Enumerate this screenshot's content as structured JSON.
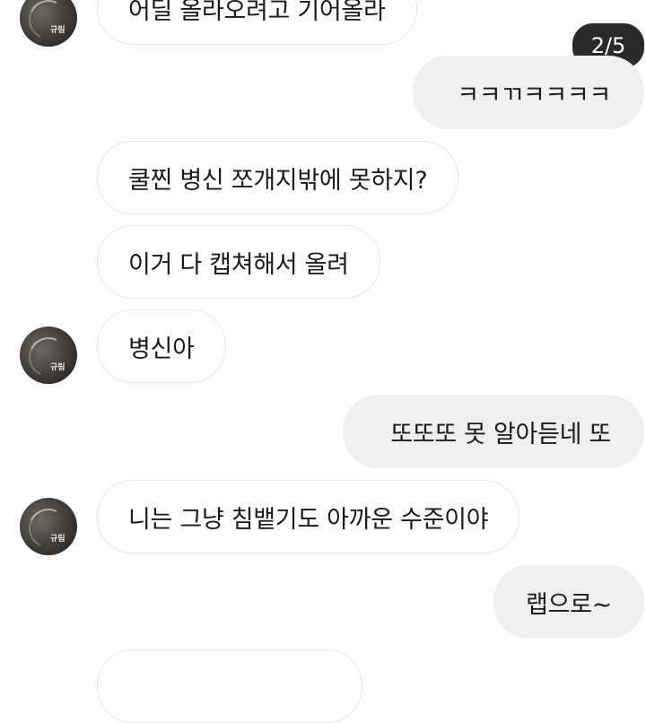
{
  "page_counter": "2/5",
  "messages": [
    {
      "direction": "incoming",
      "text": "어딜 올라오려고 기어올라",
      "avatar": true
    },
    {
      "direction": "outgoing",
      "text": "ㅋㅋㄲㅋㅋㅋㅋ"
    },
    {
      "direction": "incoming",
      "text": "쿨찐 병신 쪼개지밖에 못하지?",
      "avatar": false
    },
    {
      "direction": "incoming",
      "text": "이거 다 캡쳐해서 올려",
      "avatar": false
    },
    {
      "direction": "incoming",
      "text": "병신아",
      "avatar": true
    },
    {
      "direction": "outgoing",
      "text": "또또또 못 알아듣네 또"
    },
    {
      "direction": "incoming",
      "text": "니는 그냥 침뱉기도 아까운 수준이야",
      "avatar": true
    },
    {
      "direction": "outgoing",
      "text": "랩으로~"
    },
    {
      "direction": "incoming",
      "text": "",
      "avatar": false
    }
  ],
  "avatar_tag": "규림",
  "colors": {
    "outgoing_bubble": "#efefef",
    "incoming_border": "#e6e6e6",
    "counter_bg": "#2a2a2a"
  }
}
